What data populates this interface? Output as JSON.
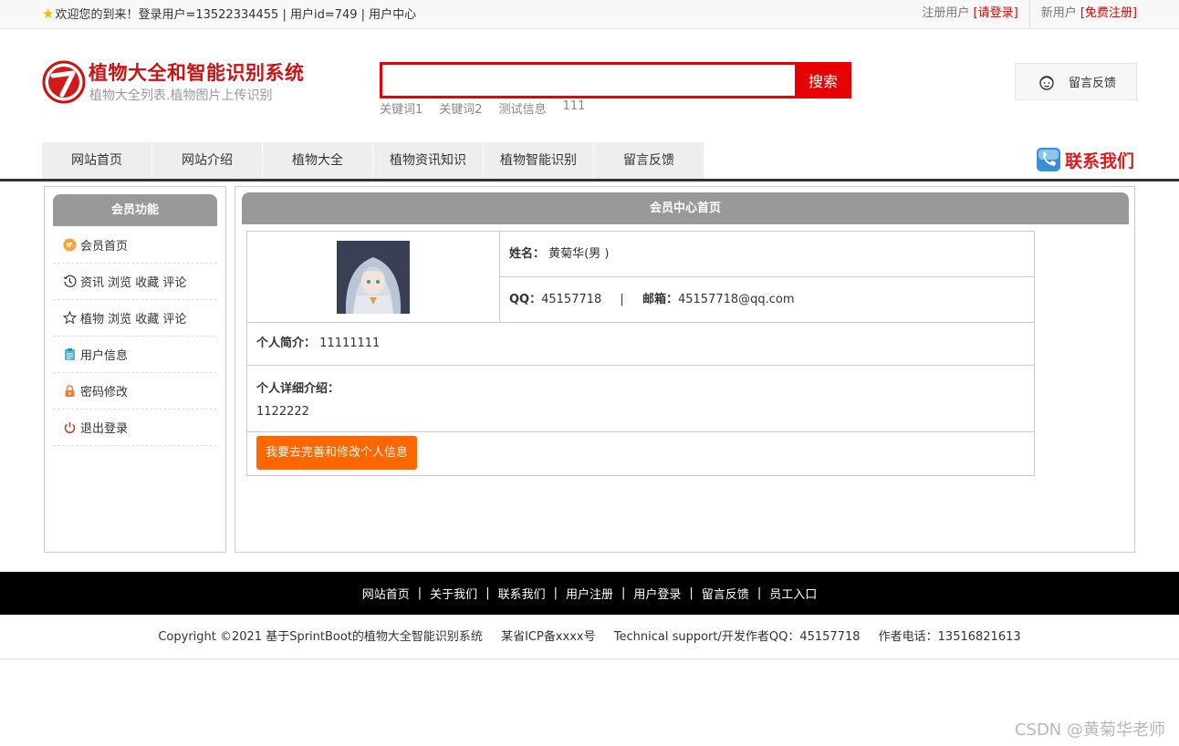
{
  "topbar": {
    "welcome": "欢迎您的到来！登录用户=13522334455 | 用户id=749 | 用户中心",
    "register_prefix": "注册用户",
    "login_link": "[请登录]",
    "new_user_prefix": "新用户",
    "free_register_link": "[免费注册]"
  },
  "header": {
    "title": "植物大全和智能识别系统",
    "subtitle": "植物大全列表.植物图片上传识别",
    "search_placeholder": "",
    "search_button": "搜索",
    "keywords": [
      "关键词1",
      "关键词2",
      "测试信息",
      "111"
    ],
    "feedback_button": "留言反馈"
  },
  "nav": {
    "items": [
      "网站首页",
      "网站介绍",
      "植物大全",
      "植物资讯知识",
      "植物智能识别",
      "留言反馈"
    ],
    "contact": "联系我们"
  },
  "sidebar": {
    "title": "会员功能",
    "items": [
      "会员首页",
      "资讯 浏览 收藏 评论",
      "植物 浏览 收藏 评论",
      "用户信息",
      "密码修改",
      "退出登录"
    ]
  },
  "main": {
    "title": "会员中心首页",
    "name_label": "姓名：",
    "name_value": "黄菊华(男 )",
    "qq_label": "QQ：",
    "qq_value": "45157718",
    "divider": "|",
    "email_label": "邮箱：",
    "email_value": "45157718@qq.com",
    "intro_label": "个人简介：",
    "intro_value": "11111111",
    "detail_label": "个人详细介绍：",
    "detail_value": "1122222",
    "edit_button": "我要去完善和修改个人信息"
  },
  "footer": {
    "links": [
      "网站首页",
      "关于我们",
      "联系我们",
      "用户注册",
      "用户登录",
      "留言反馈",
      "员工入口"
    ],
    "separator": "|",
    "copyright": "Copyright ©2021 基于SprintBoot的植物大全智能识别系统",
    "icp": "某省ICP备xxxx号",
    "support": "Technical support/开发作者QQ：45157718",
    "phone": "作者电话：13516821613"
  },
  "watermark": "CSDN @黄菊华老师"
}
